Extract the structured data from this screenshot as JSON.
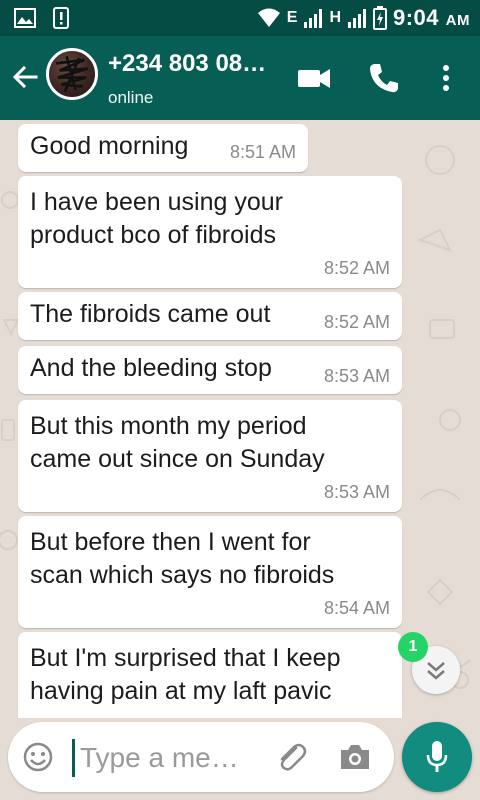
{
  "statusbar": {
    "network_e": "E",
    "network_h": "H",
    "time": "9:04",
    "ampm": "AM"
  },
  "header": {
    "contact_name": "+234 803 08…",
    "status": "online"
  },
  "messages": [
    {
      "text": "Good morning",
      "time": "8:51 AM"
    },
    {
      "text": "I have been using your\nproduct bco of fibroids",
      "time": "8:52 AM"
    },
    {
      "text": "The fibroids came out",
      "time": "8:52 AM"
    },
    {
      "text": "And the bleeding stop",
      "time": "8:53 AM"
    },
    {
      "text": "But this month my period\ncame out since on Sunday",
      "time": "8:53 AM"
    },
    {
      "text": "But before then I went for\nscan which says no fibroids",
      "time": "8:54 AM"
    },
    {
      "text": "But I'm surprised that I keep\nhaving pain at my laft pavic",
      "time": ""
    }
  ],
  "unread_count": "1",
  "composer": {
    "placeholder": "Type a me…"
  },
  "icons": {
    "back": "arrow-left-icon",
    "video": "video-camera-icon",
    "call": "phone-icon",
    "menu": "more-vert-icon",
    "emoji": "smiley-icon",
    "attach": "paperclip-icon",
    "camera": "camera-icon",
    "mic": "microphone-icon",
    "scroll": "chevron-double-down-icon"
  },
  "colors": {
    "statusbar": "#054d44",
    "appbar": "#075e54",
    "chat_bg": "#e5ddd5",
    "accent": "#128c7e",
    "badge": "#25d366"
  }
}
